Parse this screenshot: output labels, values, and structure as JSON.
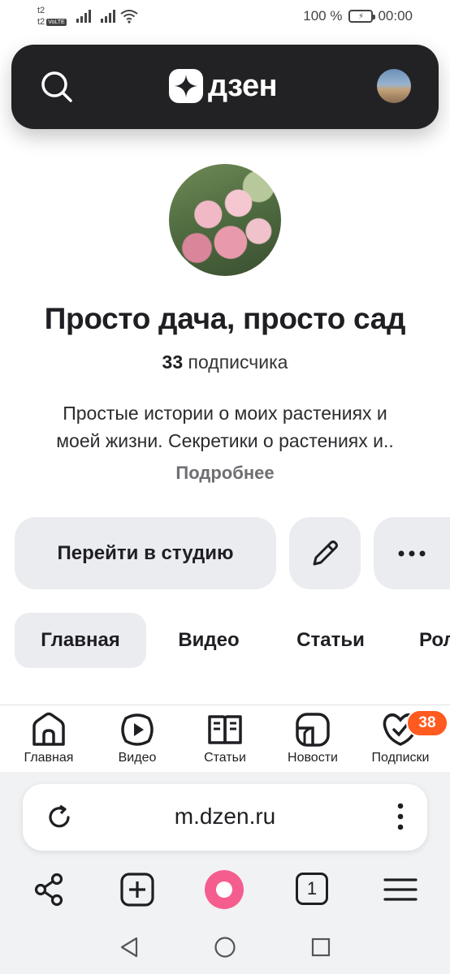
{
  "status_bar": {
    "carrier_1": "t2",
    "carrier_2": "t2",
    "volte": "VoLTE",
    "battery": "100 %",
    "time": "00:00"
  },
  "header": {
    "logo_text": "дзен",
    "icons": [
      "search-icon",
      "dzen-logo-icon",
      "user-avatar"
    ]
  },
  "channel": {
    "title": "Просто дача, просто сад",
    "subscribers_count": "33",
    "subscribers_label": "подписчика",
    "description_line1": "Простые истории о моих растениях и",
    "description_line2": "моей жизни. Секретики о растениях и..",
    "more_link": "Подробнее"
  },
  "actions": {
    "studio_label": "Перейти в студию",
    "edit_icon": "pencil-icon",
    "more_icon": "more-dots-icon"
  },
  "tabs": [
    {
      "label": "Главная",
      "active": true
    },
    {
      "label": "Видео",
      "active": false
    },
    {
      "label": "Статьи",
      "active": false
    },
    {
      "label": "Рол",
      "active": false
    }
  ],
  "bottom_nav": {
    "items": [
      {
        "label": "Главная",
        "icon": "home-icon"
      },
      {
        "label": "Видео",
        "icon": "video-play-icon"
      },
      {
        "label": "Статьи",
        "icon": "book-icon"
      },
      {
        "label": "Новости",
        "icon": "news-icon"
      },
      {
        "label": "Подписки",
        "icon": "subscriptions-icon"
      }
    ],
    "subscriptions_badge": "38"
  },
  "browser": {
    "url": "m.dzen.ru",
    "tabs_count": "1",
    "icons": [
      "reload-icon",
      "kebab-menu-icon",
      "share-icon",
      "new-tab-icon",
      "alice-icon",
      "tabs-icon",
      "hamburger-menu-icon"
    ]
  },
  "colors": {
    "header_bg": "#222225",
    "button_bg": "#ebecf0",
    "badge": "#ff5a1f",
    "alice": "#f55d8f"
  }
}
